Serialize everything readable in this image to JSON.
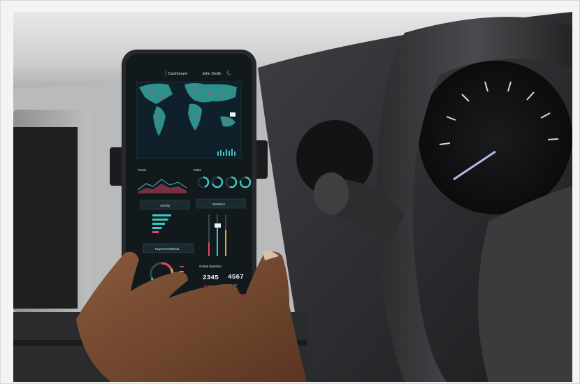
{
  "phone": {
    "header": {
      "nav_label": "Dashboard",
      "user_name": "John Smith"
    },
    "sections": {
      "trend": "Trend",
      "sales": "Sales",
      "activity": "Activity",
      "statistics": "Statistics",
      "payment_method": "Payment Method",
      "global_statistics": "Global Statistics"
    },
    "stats": {
      "value_left": "2345",
      "value_right": "4567",
      "sub_left": "ELSE",
      "sub_right": "ELSE"
    },
    "donuts": [
      {
        "percent": 45
      },
      {
        "percent": 70
      },
      {
        "percent": 55
      },
      {
        "percent": 80
      }
    ],
    "activity_bars": [
      0.9,
      0.75,
      0.6,
      0.45,
      0.3
    ],
    "colors": {
      "screen_bg": "#11191d",
      "accent_teal": "#3ec6c0",
      "accent_pink": "#e0466b",
      "accent_orange": "#f2a23a",
      "map_land": "#2f8f8a"
    }
  },
  "icons": {
    "status": "moon-icon"
  }
}
